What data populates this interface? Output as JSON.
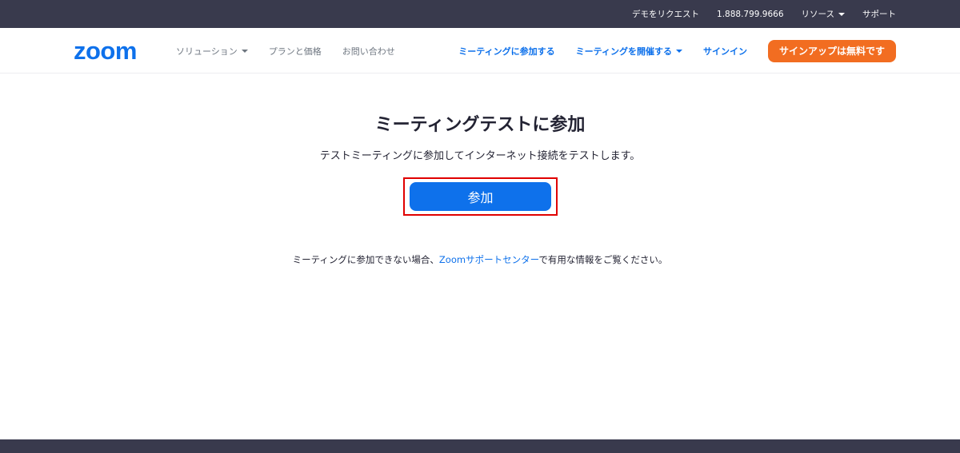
{
  "topbar": {
    "links": [
      {
        "label": "デモをリクエスト"
      },
      {
        "label": "1.888.799.9666"
      },
      {
        "label": "リソース"
      },
      {
        "label": "サポート"
      }
    ]
  },
  "navbar": {
    "logo_text": "zoom",
    "left_items": [
      {
        "label": "ソリューション"
      },
      {
        "label": "プランと価格"
      },
      {
        "label": "お問い合わせ"
      }
    ],
    "right_items": [
      {
        "label": "ミーティングに参加する"
      },
      {
        "label": "ミーティングを開催する"
      },
      {
        "label": "サインイン"
      }
    ],
    "signup_label": "サインアップは無料です"
  },
  "main": {
    "title": "ミーティングテストに参加",
    "description": "テストミーティングに参加してインターネット接続をテストします。",
    "join_label": "参加",
    "help_prefix": "ミーティングに参加できない場合、",
    "help_link": "Zoomサポートセンター",
    "help_suffix": "で有用な情報をご覧ください。"
  },
  "colors": {
    "topbar_bg": "#393a4d",
    "brand_blue": "#0e71eb",
    "signup_orange": "#f26d21",
    "highlight_red": "#e00000"
  }
}
